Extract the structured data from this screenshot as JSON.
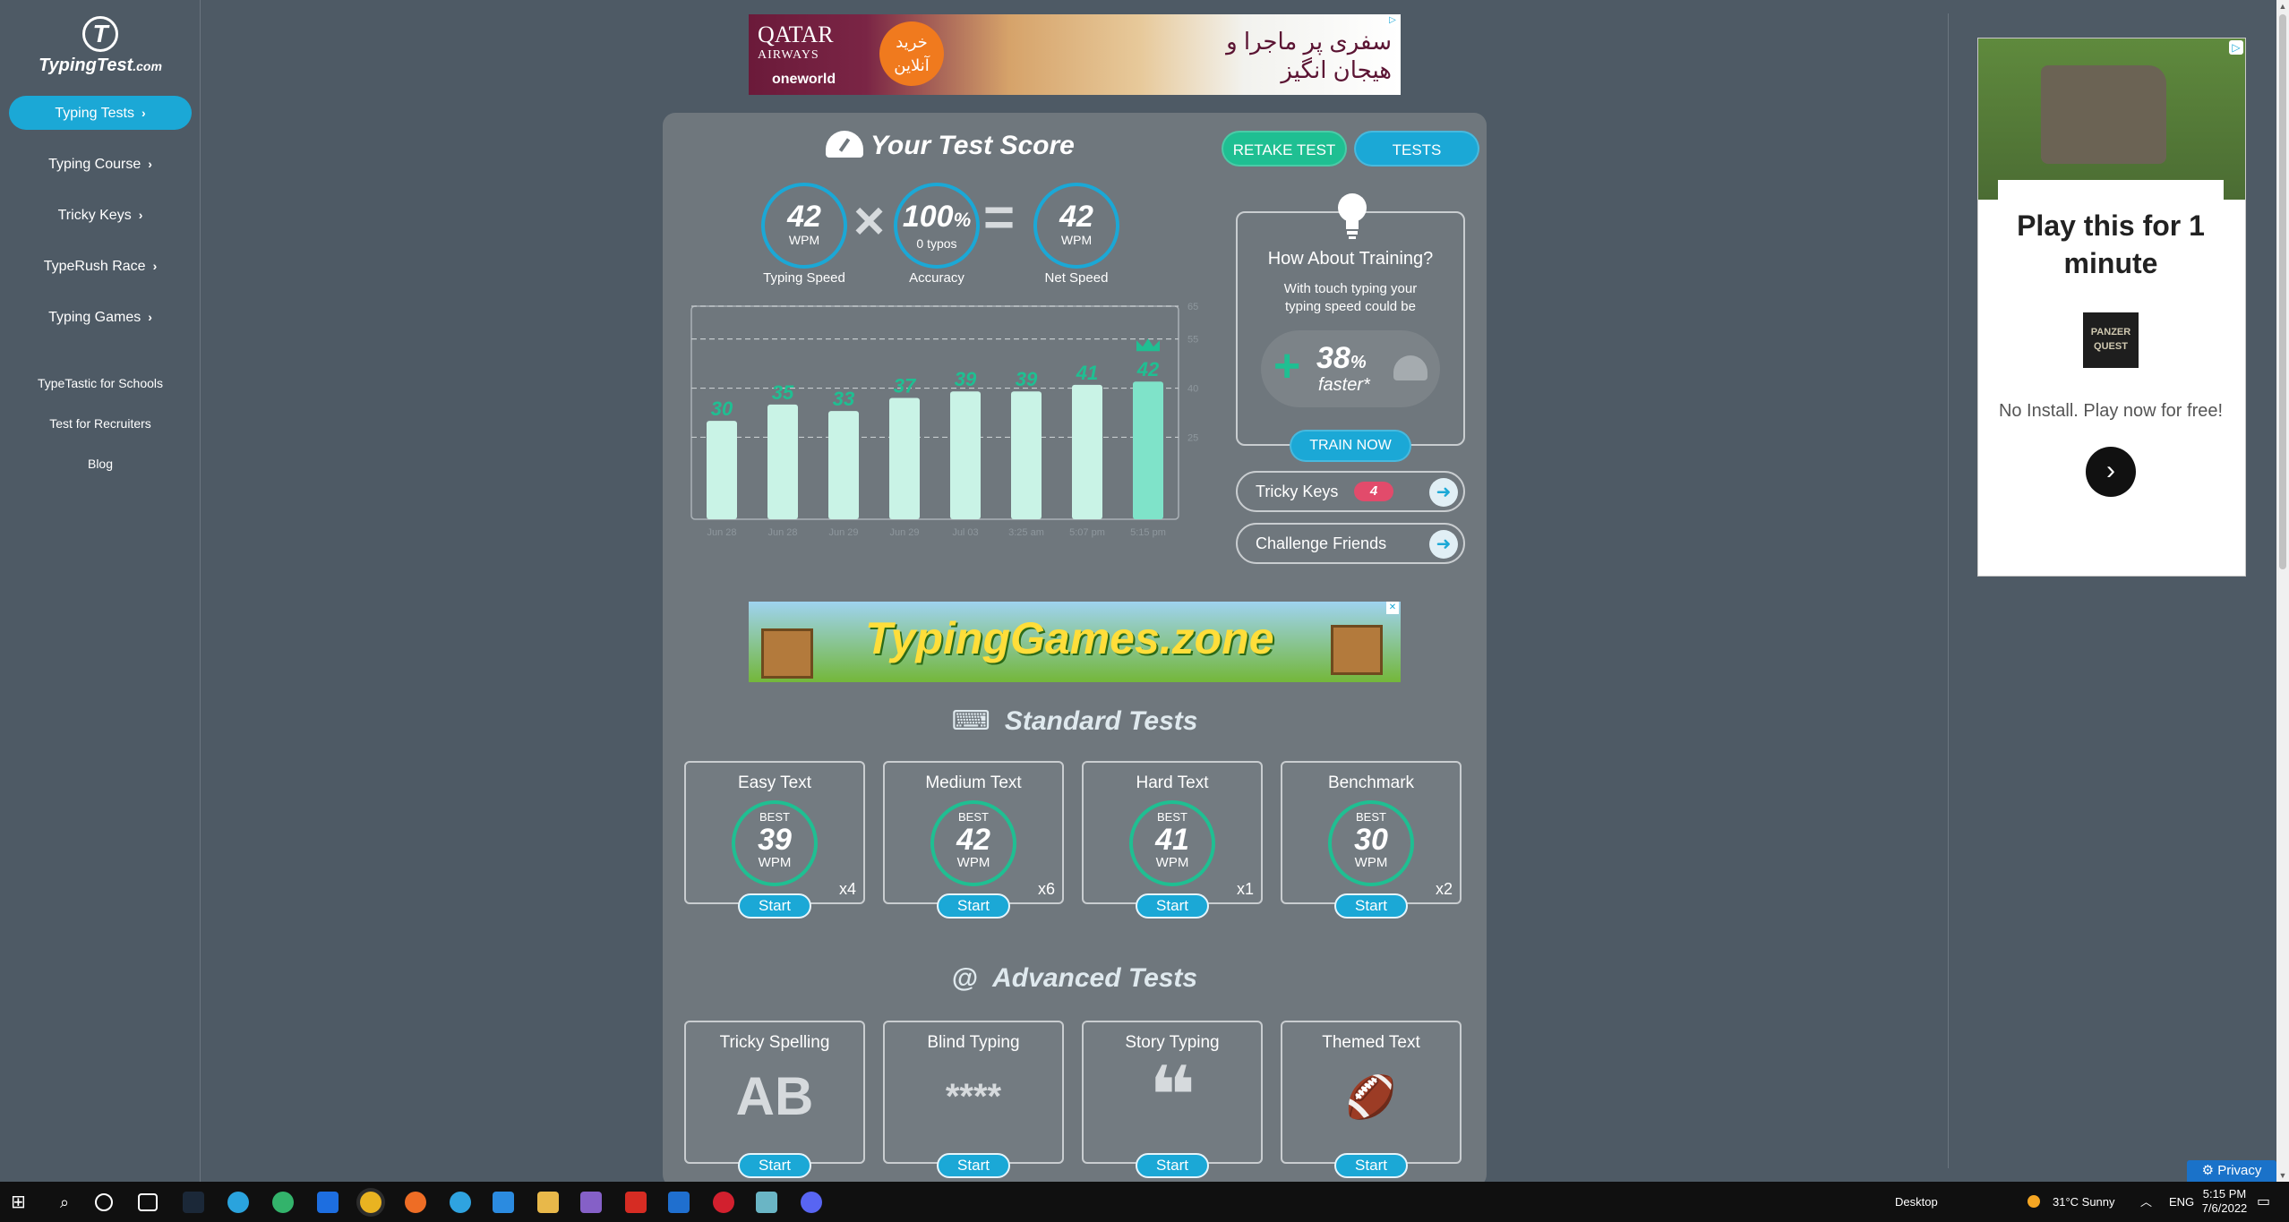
{
  "sidebar": {
    "logo_text": "TypingTest",
    "logo_suffix": ".com",
    "nav": [
      {
        "label": "Typing Tests",
        "active": true
      },
      {
        "label": "Typing Course",
        "active": false
      },
      {
        "label": "Tricky Keys",
        "active": false
      },
      {
        "label": "TypeRush Race",
        "active": false
      },
      {
        "label": "Typing Games",
        "active": false
      }
    ],
    "links": [
      "TypeTastic for Schools",
      "Test for Recruiters",
      "Blog"
    ]
  },
  "ads": {
    "top": {
      "brand": "QATAR",
      "brand_sub": "AIRWAYS",
      "alliance": "oneworld",
      "badge": "خرید آنلاین",
      "slogan_line1": "سفری پر ماجرا و",
      "slogan_line2": "هیجان انگیز"
    },
    "games": {
      "logo": "TypingGames.zone"
    },
    "right": {
      "title": "Play this for 1 minute",
      "game_name": "PANZER QUEST",
      "subtitle": "No Install. Play now for free!"
    }
  },
  "score": {
    "title": "Your Test Score",
    "retake_label": "RETAKE TEST",
    "tests_label": "TESTS",
    "typing_speed": {
      "value": "42",
      "unit": "WPM",
      "label": "Typing Speed"
    },
    "accuracy": {
      "value": "100",
      "pct": "%",
      "unit": "0 typos",
      "label": "Accuracy"
    },
    "net_speed": {
      "value": "42",
      "unit": "WPM",
      "label": "Net Speed"
    }
  },
  "chart_data": {
    "type": "bar",
    "categories": [
      "Jun 28",
      "Jun 28",
      "Jun 29",
      "Jun 29",
      "Jul 03",
      "3:25 am",
      "5:07 pm",
      "5:15 pm"
    ],
    "values": [
      30,
      35,
      33,
      37,
      39,
      39,
      41,
      42
    ],
    "ylim": [
      0,
      65
    ],
    "y_ticks": [
      25,
      40,
      55,
      65
    ],
    "grid": true,
    "highlight_last": true
  },
  "training": {
    "heading": "How About Training?",
    "desc": "With touch typing your typing speed could be",
    "boost_value": "38",
    "boost_pct": "%",
    "boost_word": "faster*",
    "button": "TRAIN NOW"
  },
  "tricky_keys": {
    "label": "Tricky Keys",
    "count": "4"
  },
  "challenge": {
    "label": "Challenge Friends"
  },
  "standard_tests": {
    "title": "Standard Tests",
    "items": [
      {
        "name": "Easy Text",
        "best": "BEST",
        "wpm_value": "39",
        "wpm": "WPM",
        "count": "x4",
        "start": "Start"
      },
      {
        "name": "Medium Text",
        "best": "BEST",
        "wpm_value": "42",
        "wpm": "WPM",
        "count": "x6",
        "start": "Start"
      },
      {
        "name": "Hard Text",
        "best": "BEST",
        "wpm_value": "41",
        "wpm": "WPM",
        "count": "x1",
        "start": "Start"
      },
      {
        "name": "Benchmark",
        "best": "BEST",
        "wpm_value": "30",
        "wpm": "WPM",
        "count": "x2",
        "start": "Start"
      }
    ]
  },
  "advanced_tests": {
    "title": "Advanced Tests",
    "items": [
      {
        "name": "Tricky Spelling",
        "icon": "AB",
        "start": "Start"
      },
      {
        "name": "Blind Typing",
        "icon": "****",
        "start": "Start"
      },
      {
        "name": "Story Typing",
        "icon": "❝",
        "start": "Start"
      },
      {
        "name": "Themed Text",
        "icon": "🏈",
        "start": "Start"
      }
    ]
  },
  "privacy": "Privacy",
  "taskbar": {
    "desktop_label": "Desktop",
    "weather": "31°C  Sunny",
    "lang": "ENG",
    "time": "5:15 PM",
    "date": "7/6/2022"
  },
  "colors": {
    "accent": "#1ba8d6",
    "green": "#1fbf92",
    "panel": "#6f777d",
    "bg": "#4e5a65"
  }
}
